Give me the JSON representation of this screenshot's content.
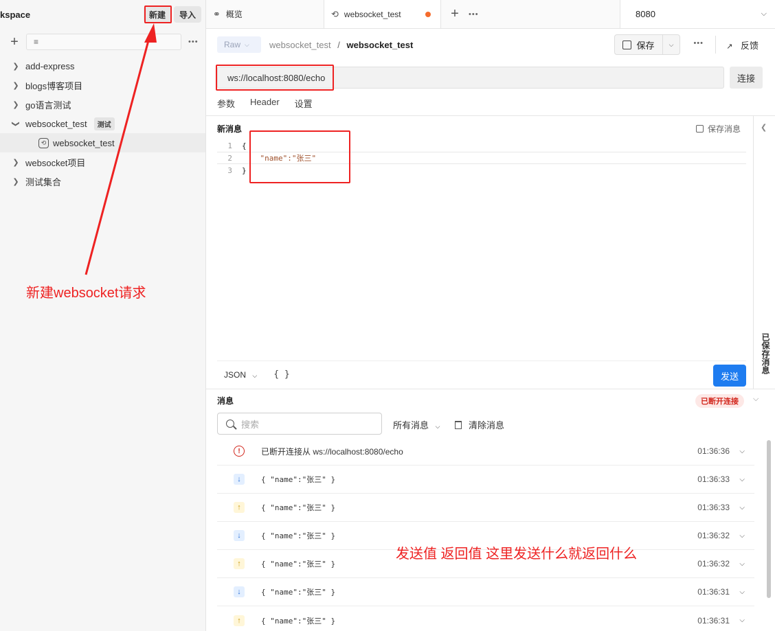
{
  "sidebar": {
    "workspace_title": "kspace",
    "new_label": "新建",
    "import_label": "导入",
    "items": [
      {
        "label": "add-express",
        "expanded": false
      },
      {
        "label": "blogs博客项目",
        "expanded": false
      },
      {
        "label": "go语言测试",
        "expanded": false
      },
      {
        "label": "websocket_test",
        "expanded": true,
        "tag": "测试"
      },
      {
        "label": "websocket_test",
        "child": true
      },
      {
        "label": "websocket项目",
        "expanded": false
      },
      {
        "label": "测试集合",
        "expanded": false
      }
    ]
  },
  "tabs": {
    "overview_label": "概览",
    "active_label": "websocket_test",
    "environment": "8080"
  },
  "toolbar": {
    "mode": "Raw",
    "breadcrumb_parent": "websocket_test",
    "breadcrumb_current": "websocket_test",
    "save_label": "保存",
    "feedback_label": "反馈"
  },
  "request": {
    "url": "ws://localhost:8080/echo",
    "connect_label": "连接",
    "subtabs": [
      "参数",
      "Header",
      "设置"
    ]
  },
  "editor": {
    "title": "新消息",
    "save_message_label": "保存消息",
    "lines": [
      "{",
      "    \"name\":\"张三\"",
      "}"
    ],
    "format": "JSON",
    "beautify_label": "{ }",
    "send_label": "发送",
    "side_rail_label": "已保存消息"
  },
  "messages": {
    "title": "消息",
    "status": "已断开连接",
    "search_placeholder": "搜索",
    "filter_label": "所有消息",
    "clear_label": "清除消息",
    "items": [
      {
        "type": "error",
        "text": "已断开连接从 ws://localhost:8080/echo",
        "time": "01:36:36"
      },
      {
        "type": "received",
        "text": "{ \"name\":\"张三\" }",
        "time": "01:36:33"
      },
      {
        "type": "sent",
        "text": "{ \"name\":\"张三\" }",
        "time": "01:36:33"
      },
      {
        "type": "received",
        "text": "{ \"name\":\"张三\" }",
        "time": "01:36:32"
      },
      {
        "type": "sent",
        "text": "{ \"name\":\"张三\" }",
        "time": "01:36:32"
      },
      {
        "type": "received",
        "text": "{ \"name\":\"张三\" }",
        "time": "01:36:31"
      },
      {
        "type": "sent",
        "text": "{ \"name\":\"张三\" }",
        "time": "01:36:31"
      }
    ]
  },
  "annotations": {
    "new_request_note": "新建websocket请求",
    "echo_note": "发送值 返回值 这里发送什么就返回什么",
    "color": "#ee2222"
  }
}
